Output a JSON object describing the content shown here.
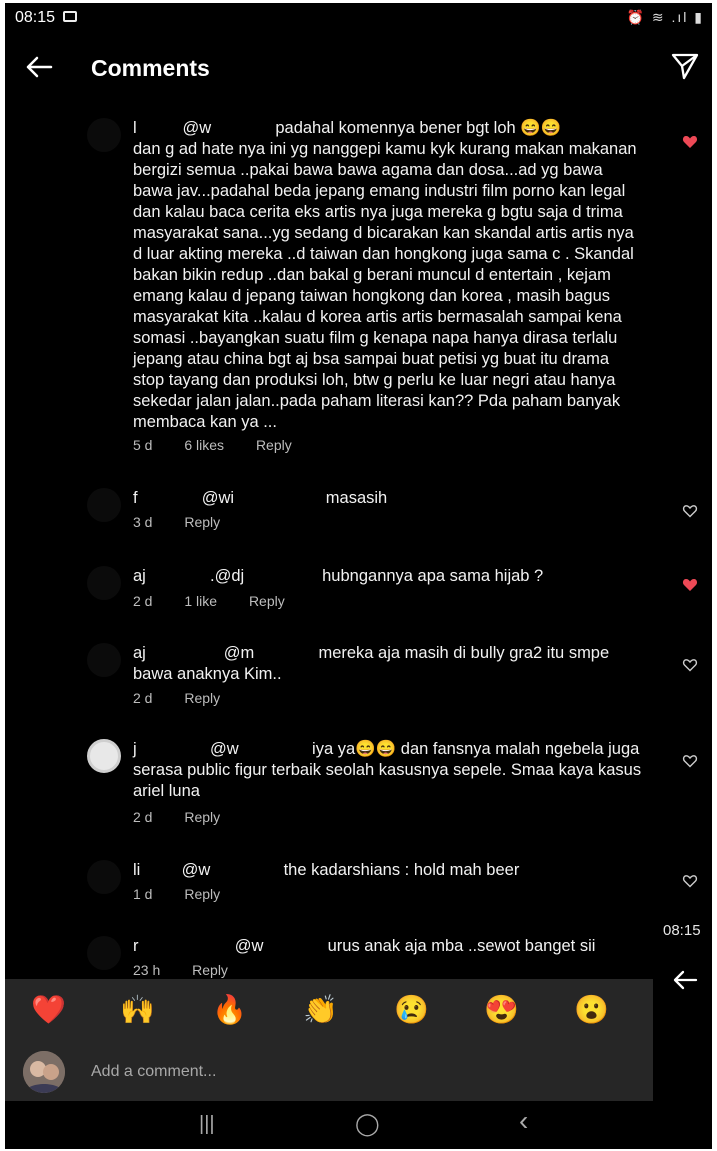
{
  "status": {
    "time": "08:15",
    "image_icon": "image-icon",
    "system_icons": "⏰ ≋ .ıl ▮"
  },
  "header": {
    "title": "Comments",
    "back_icon": "arrow-left-icon",
    "share_icon": "send-icon"
  },
  "comments": [
    {
      "text": "l          @w              padahal komennya bener bgt loh 😄😄\ndan g ad hate nya ini yg nanggepi kamu kyk kurang makan makanan\nbergizi semua ..pakai bawa bawa agama dan dosa...ad yg bawa\nbawa jav...padahal beda jepang emang industri film porno kan legal\ndan kalau baca cerita eks artis nya juga mereka g bgtu saja d trima\nmasyarakat sana...yg sedang d bicarakan kan skandal artis artis nya\nd luar akting mereka ..d taiwan dan hongkong juga sama c . Skandal\nbakan bikin redup ..dan bakal g berani muncul d entertain , kejam\nemang kalau d jepang taiwan hongkong dan korea , masih bagus\nmasyarakat kita ..kalau d korea artis artis bermasalah sampai kena\nsomasi ..bayangkan suatu film g kenapa napa hanya dirasa terlalu\njepang atau china bgt aj bsa sampai buat petisi yg buat itu drama\nstop tayang dan produksi loh, btw g perlu ke luar negri atau hanya\nsekedar jalan jalan..pada paham literasi kan?? Pda paham banyak\nmembaca kan ya ...",
      "time": "5 d",
      "likes": "6 likes",
      "reply": "Reply",
      "liked": true
    },
    {
      "text": "f              @wi                    masasih",
      "time": "3 d",
      "likes": "",
      "reply": "Reply",
      "liked": false
    },
    {
      "text": "aj              .@dj                 hubngannya apa sama hijab ?",
      "time": "2 d",
      "likes": "1 like",
      "reply": "Reply",
      "liked": true
    },
    {
      "text": "aj                 @m              mereka aja masih di bully gra2 itu smpe\nbawa anaknya Kim..",
      "time": "2 d",
      "likes": "",
      "reply": "Reply",
      "liked": false
    },
    {
      "text": "j                @w                iya ya😄😄 dan fansnya malah ngebela juga\nserasa public figur terbaik seolah kasusnya sepele. Smaa kaya kasus\nariel luna",
      "time": "2 d",
      "likes": "",
      "reply": "Reply",
      "liked": false
    },
    {
      "text": "li         @w                the kadarshians : hold mah beer",
      "time": "1 d",
      "likes": "",
      "reply": "Reply",
      "liked": false
    },
    {
      "text": "r                     @w              urus anak aja mba ..sewot banget sii",
      "time": "23 h",
      "likes": "",
      "reply": "Reply",
      "liked": false
    }
  ],
  "reactions": [
    "❤️",
    "🙌",
    "🔥",
    "👏",
    "😢",
    "😍",
    "😮"
  ],
  "composer": {
    "placeholder": "Add a comment..."
  },
  "overlay": {
    "time": "08:15",
    "back_icon": "arrow-left-icon"
  },
  "nav": {
    "recents": "|||",
    "home": "◯",
    "back": "‹"
  },
  "colors": {
    "background": "#000000",
    "like_red": "#ed4956",
    "bar": "#262626"
  }
}
